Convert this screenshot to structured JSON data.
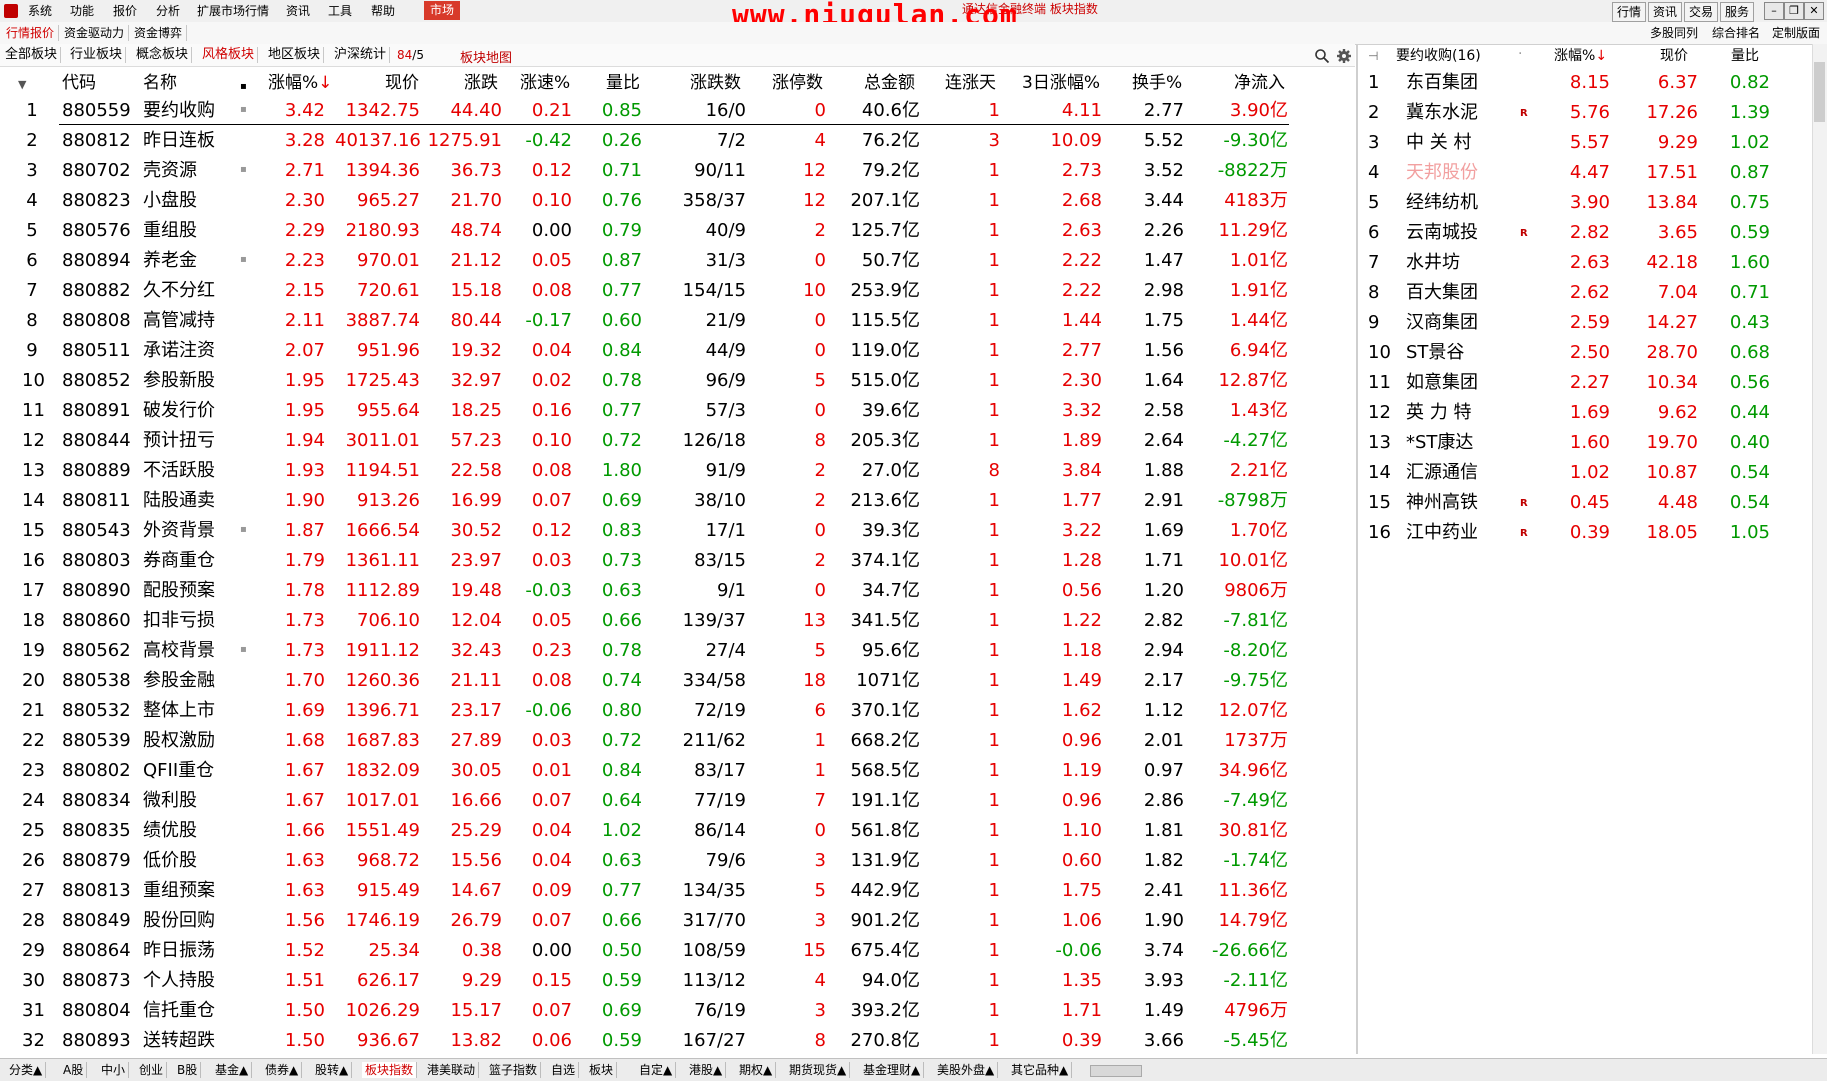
{
  "menubar": {
    "items": [
      "系统",
      "功能",
      "报价",
      "分析",
      "扩展市场行情",
      "资讯",
      "工具",
      "帮助",
      "市场"
    ],
    "watermark": "www.niugulan.com",
    "subtitle": "通达信金融终端 板块指数",
    "right_buttons": [
      "行情",
      "资讯",
      "交易",
      "服务"
    ]
  },
  "tabrow2": {
    "items": [
      "行情报价",
      "资金驱动力",
      "资金博弈"
    ],
    "right_items": [
      "多股同列",
      "综合排名",
      "定制版面"
    ]
  },
  "tabrow3": {
    "items": [
      "全部板块",
      "行业板块",
      "概念板块",
      "风格板块",
      "地区板块",
      "沪深统计"
    ],
    "count_a": "84",
    "count_sep": "/5",
    "map_label": "板块地图"
  },
  "table": {
    "headers": [
      "代码",
      "名称",
      "涨幅%",
      "现价",
      "涨跌",
      "涨速%",
      "量比",
      "涨跌数",
      "涨停数",
      "总金额",
      "连涨天",
      "3日涨幅%",
      "换手%",
      "净流入"
    ],
    "rows": [
      [
        "1",
        "880559",
        "要约收购",
        "3.42",
        "1342.75",
        "44.40",
        "0.21",
        "0.85",
        "16/0",
        "0",
        "40.6亿",
        "1",
        "4.11",
        "2.77",
        "3.90亿"
      ],
      [
        "2",
        "880812",
        "昨日连板",
        "3.28",
        "40137.16",
        "1275.91",
        "-0.42",
        "0.26",
        "7/2",
        "4",
        "76.2亿",
        "3",
        "10.09",
        "5.52",
        "-9.30亿"
      ],
      [
        "3",
        "880702",
        "壳资源",
        "2.71",
        "1394.36",
        "36.73",
        "0.12",
        "0.71",
        "90/11",
        "12",
        "79.2亿",
        "1",
        "2.73",
        "3.52",
        "-8822万"
      ],
      [
        "4",
        "880823",
        "小盘股",
        "2.30",
        "965.27",
        "21.70",
        "0.10",
        "0.76",
        "358/37",
        "12",
        "207.1亿",
        "1",
        "2.68",
        "3.44",
        "4183万"
      ],
      [
        "5",
        "880576",
        "重组股",
        "2.29",
        "2180.93",
        "48.74",
        "0.00",
        "0.79",
        "40/9",
        "2",
        "125.7亿",
        "1",
        "2.63",
        "2.26",
        "11.29亿"
      ],
      [
        "6",
        "880894",
        "养老金",
        "2.23",
        "970.01",
        "21.12",
        "0.05",
        "0.87",
        "31/3",
        "0",
        "50.7亿",
        "1",
        "2.22",
        "1.47",
        "1.01亿"
      ],
      [
        "7",
        "880882",
        "久不分红",
        "2.15",
        "720.61",
        "15.18",
        "0.08",
        "0.77",
        "154/15",
        "10",
        "253.9亿",
        "1",
        "2.22",
        "2.98",
        "1.91亿"
      ],
      [
        "8",
        "880808",
        "高管减持",
        "2.11",
        "3887.74",
        "80.44",
        "-0.17",
        "0.60",
        "21/9",
        "0",
        "115.5亿",
        "1",
        "1.44",
        "1.75",
        "1.44亿"
      ],
      [
        "9",
        "880511",
        "承诺注资",
        "2.07",
        "951.96",
        "19.32",
        "0.04",
        "0.84",
        "44/9",
        "0",
        "119.0亿",
        "1",
        "2.77",
        "1.56",
        "6.94亿"
      ],
      [
        "10",
        "880852",
        "参股新股",
        "1.95",
        "1725.43",
        "32.97",
        "0.02",
        "0.78",
        "96/9",
        "5",
        "515.0亿",
        "1",
        "2.30",
        "1.64",
        "12.87亿"
      ],
      [
        "11",
        "880891",
        "破发行价",
        "1.95",
        "955.64",
        "18.25",
        "0.16",
        "0.77",
        "57/3",
        "0",
        "39.6亿",
        "1",
        "3.32",
        "2.58",
        "1.43亿"
      ],
      [
        "12",
        "880844",
        "预计扭亏",
        "1.94",
        "3011.01",
        "57.23",
        "0.10",
        "0.72",
        "126/18",
        "8",
        "205.3亿",
        "1",
        "1.89",
        "2.64",
        "-4.27亿"
      ],
      [
        "13",
        "880889",
        "不活跃股",
        "1.93",
        "1194.51",
        "22.58",
        "0.08",
        "1.80",
        "91/9",
        "2",
        "27.0亿",
        "8",
        "3.84",
        "1.88",
        "2.21亿"
      ],
      [
        "14",
        "880811",
        "陆股通卖",
        "1.90",
        "913.26",
        "16.99",
        "0.07",
        "0.69",
        "38/10",
        "2",
        "213.6亿",
        "1",
        "1.77",
        "2.91",
        "-8798万"
      ],
      [
        "15",
        "880543",
        "外资背景",
        "1.87",
        "1666.54",
        "30.52",
        "0.12",
        "0.83",
        "17/1",
        "0",
        "39.3亿",
        "1",
        "3.22",
        "1.69",
        "1.70亿"
      ],
      [
        "16",
        "880803",
        "券商重仓",
        "1.79",
        "1361.11",
        "23.97",
        "0.03",
        "0.73",
        "83/15",
        "2",
        "374.1亿",
        "1",
        "1.28",
        "1.71",
        "10.01亿"
      ],
      [
        "17",
        "880890",
        "配股预案",
        "1.78",
        "1112.89",
        "19.48",
        "-0.03",
        "0.63",
        "9/1",
        "0",
        "34.7亿",
        "1",
        "0.56",
        "1.20",
        "9806万"
      ],
      [
        "18",
        "880860",
        "扣非亏损",
        "1.73",
        "706.10",
        "12.04",
        "0.05",
        "0.66",
        "139/37",
        "13",
        "341.5亿",
        "1",
        "1.22",
        "2.82",
        "-7.81亿"
      ],
      [
        "19",
        "880562",
        "高校背景",
        "1.73",
        "1911.12",
        "32.43",
        "0.23",
        "0.78",
        "27/4",
        "5",
        "95.6亿",
        "1",
        "1.18",
        "2.94",
        "-8.20亿"
      ],
      [
        "20",
        "880538",
        "参股金融",
        "1.70",
        "1260.36",
        "21.11",
        "0.08",
        "0.74",
        "334/58",
        "18",
        "1071亿",
        "1",
        "1.49",
        "2.17",
        "-9.75亿"
      ],
      [
        "21",
        "880532",
        "整体上市",
        "1.69",
        "1396.71",
        "23.17",
        "-0.06",
        "0.80",
        "72/19",
        "6",
        "370.1亿",
        "1",
        "1.62",
        "1.12",
        "12.07亿"
      ],
      [
        "22",
        "880539",
        "股权激励",
        "1.68",
        "1687.83",
        "27.89",
        "0.03",
        "0.72",
        "211/62",
        "1",
        "668.2亿",
        "1",
        "0.96",
        "2.01",
        "1737万"
      ],
      [
        "23",
        "880802",
        "QFII重仓",
        "1.67",
        "1832.09",
        "30.05",
        "0.01",
        "0.84",
        "83/17",
        "1",
        "568.5亿",
        "1",
        "1.19",
        "0.97",
        "34.96亿"
      ],
      [
        "24",
        "880834",
        "微利股",
        "1.67",
        "1017.01",
        "16.66",
        "0.07",
        "0.64",
        "77/19",
        "7",
        "191.1亿",
        "1",
        "0.96",
        "2.86",
        "-7.49亿"
      ],
      [
        "25",
        "880835",
        "绩优股",
        "1.66",
        "1551.49",
        "25.29",
        "0.04",
        "1.02",
        "86/14",
        "0",
        "561.8亿",
        "1",
        "1.10",
        "1.81",
        "30.81亿"
      ],
      [
        "26",
        "880879",
        "低价股",
        "1.63",
        "968.72",
        "15.56",
        "0.04",
        "0.63",
        "79/6",
        "3",
        "131.9亿",
        "1",
        "0.60",
        "1.82",
        "-1.74亿"
      ],
      [
        "27",
        "880813",
        "重组预案",
        "1.63",
        "915.49",
        "14.67",
        "0.09",
        "0.77",
        "134/35",
        "5",
        "442.9亿",
        "1",
        "1.75",
        "2.41",
        "11.36亿"
      ],
      [
        "28",
        "880849",
        "股份回购",
        "1.56",
        "1746.19",
        "26.79",
        "0.07",
        "0.66",
        "317/70",
        "3",
        "901.2亿",
        "1",
        "1.06",
        "1.90",
        "14.79亿"
      ],
      [
        "29",
        "880864",
        "昨日振荡",
        "1.52",
        "25.34",
        "0.38",
        "0.00",
        "0.50",
        "108/59",
        "15",
        "675.4亿",
        "1",
        "-0.06",
        "3.74",
        "-26.66亿"
      ],
      [
        "30",
        "880873",
        "个人持股",
        "1.51",
        "626.17",
        "9.29",
        "0.15",
        "0.59",
        "113/12",
        "4",
        "94.0亿",
        "1",
        "1.35",
        "3.93",
        "-2.11亿"
      ],
      [
        "31",
        "880804",
        "信托重仓",
        "1.50",
        "1026.29",
        "15.17",
        "0.07",
        "0.69",
        "76/19",
        "3",
        "393.2亿",
        "1",
        "1.71",
        "1.49",
        "4796万"
      ],
      [
        "32",
        "880893",
        "送转超跌",
        "1.50",
        "936.67",
        "13.82",
        "0.06",
        "0.59",
        "167/27",
        "8",
        "270.8亿",
        "1",
        "0.39",
        "3.66",
        "-5.45亿"
      ]
    ]
  },
  "rpanel": {
    "title": "要约收购(16)",
    "headers": [
      "涨幅%",
      "现价",
      "量比"
    ],
    "rows": [
      [
        "1",
        "东百集团",
        "",
        "8.15",
        "6.37",
        "0.82"
      ],
      [
        "2",
        "冀东水泥",
        "R",
        "5.76",
        "17.26",
        "1.39"
      ],
      [
        "3",
        "中 关 村",
        "",
        "5.57",
        "9.29",
        "1.02"
      ],
      [
        "4",
        "天邦股份",
        "",
        "4.47",
        "17.51",
        "0.87"
      ],
      [
        "5",
        "经纬纺机",
        "",
        "3.90",
        "13.84",
        "0.75"
      ],
      [
        "6",
        "云南城投",
        "R",
        "2.82",
        "3.65",
        "0.59"
      ],
      [
        "7",
        "水井坊",
        "",
        "2.63",
        "42.18",
        "1.60"
      ],
      [
        "8",
        "百大集团",
        "",
        "2.62",
        "7.04",
        "0.71"
      ],
      [
        "9",
        "汉商集团",
        "",
        "2.59",
        "14.27",
        "0.43"
      ],
      [
        "10",
        "ST景谷",
        "",
        "2.50",
        "28.70",
        "0.68"
      ],
      [
        "11",
        "如意集团",
        "",
        "2.27",
        "10.34",
        "0.56"
      ],
      [
        "12",
        "英 力 特",
        "",
        "1.69",
        "9.62",
        "0.44"
      ],
      [
        "13",
        "*ST康达",
        "",
        "1.60",
        "19.70",
        "0.40"
      ],
      [
        "14",
        "汇源通信",
        "",
        "1.02",
        "10.87",
        "0.54"
      ],
      [
        "15",
        "神州高铁",
        "R",
        "0.45",
        "4.48",
        "0.54"
      ],
      [
        "16",
        "江中药业",
        "R",
        "0.39",
        "18.05",
        "1.05"
      ]
    ]
  },
  "bottombar": {
    "items": [
      "分类▲",
      "A股",
      "中小",
      "创业",
      "B股",
      "基金▲",
      "债券▲",
      "股转▲",
      "板块指数",
      "港美联动",
      "篮子指数",
      "自选",
      "板块",
      "自定▲",
      "港股▲",
      "期权▲",
      "期货现货▲",
      "基金理财▲",
      "美股外盘▲",
      "其它品种▲"
    ]
  }
}
